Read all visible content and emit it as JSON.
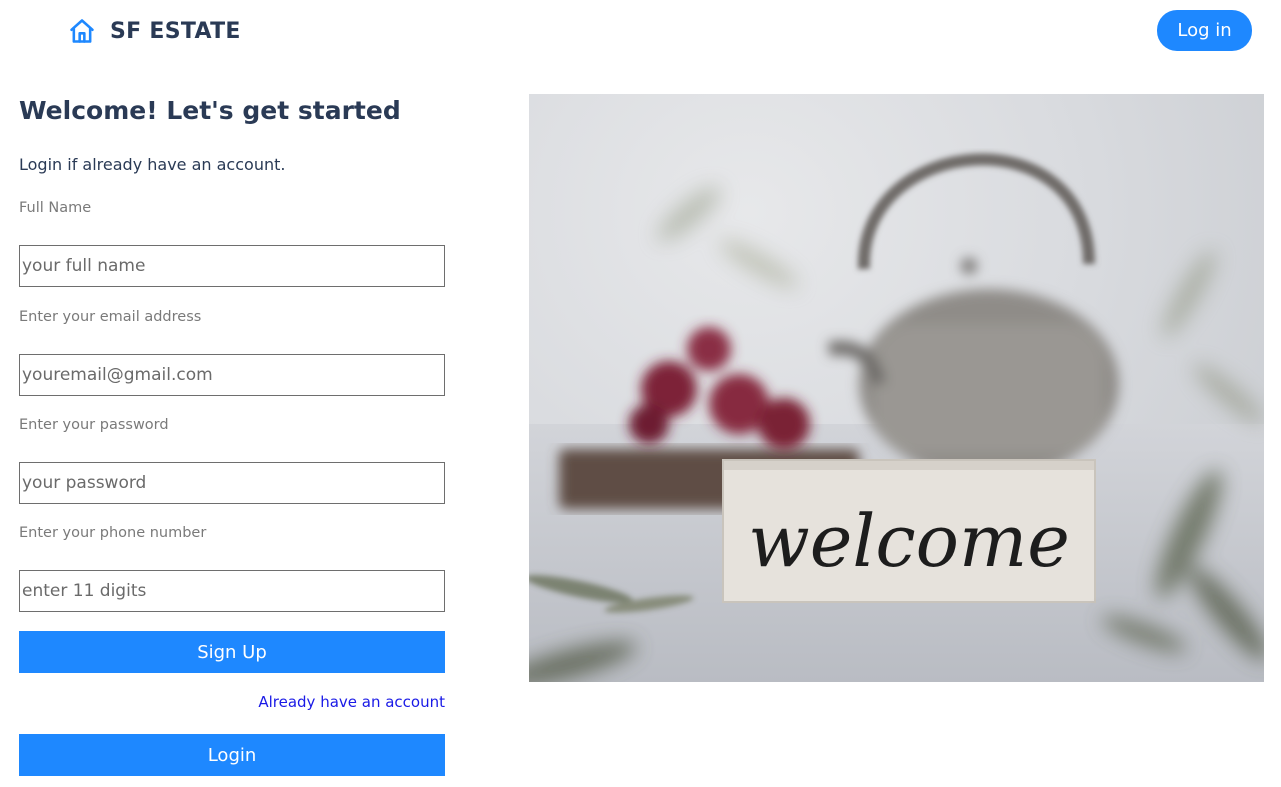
{
  "header": {
    "brand": "SF ESTATE",
    "brand_icon": "home-icon",
    "login_label": "Log in"
  },
  "form": {
    "heading": "Welcome! Let's get started",
    "subtitle": "Login if already have an account.",
    "fields": [
      {
        "label": "Full Name",
        "placeholder": "your full name"
      },
      {
        "label": "Enter your email address",
        "placeholder": "youremail@gmail.com"
      },
      {
        "label": "Enter your password",
        "placeholder": "your password"
      },
      {
        "label": "Enter your phone number",
        "placeholder": "enter 11 digits"
      }
    ],
    "signup_label": "Sign Up",
    "account_link": "Already have an account",
    "login_label": "Login"
  },
  "hero": {
    "sign_text": "welcome"
  },
  "colors": {
    "accent": "#1e88ff",
    "heading": "#2a3a55",
    "link": "#1a1ae6"
  }
}
